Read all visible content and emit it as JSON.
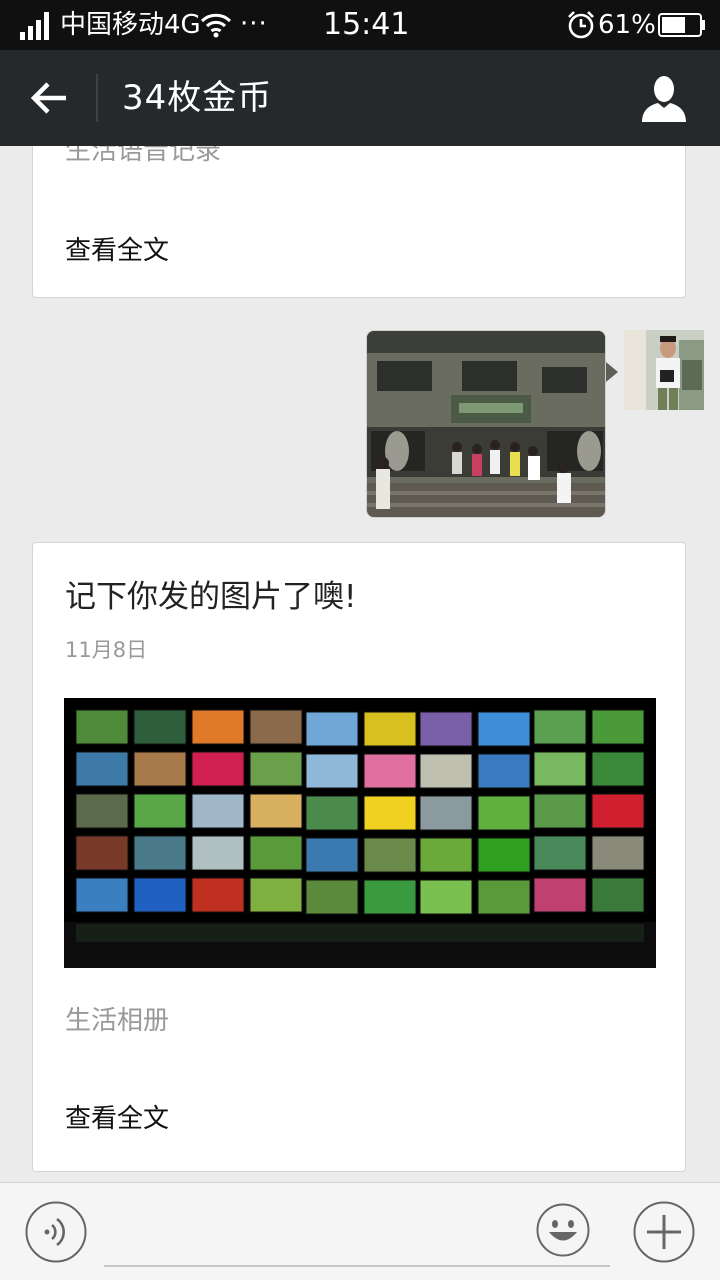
{
  "status_bar": {
    "carrier": "中国移动4G",
    "dots": "···",
    "time": "15:41",
    "battery_pct": "61%",
    "icons": [
      "signal-icon",
      "wifi-icon",
      "alarm-icon",
      "battery-icon"
    ]
  },
  "header": {
    "title": "34枚金币",
    "icons": [
      "back-arrow-icon",
      "profile-icon"
    ],
    "background": "#25292c"
  },
  "messages": [
    {
      "type": "card",
      "description": "生活语音记录",
      "view_all": "查看全文"
    },
    {
      "type": "image",
      "sender": "self",
      "image": "photo-building-entrance",
      "avatar": "avatar-photo"
    },
    {
      "type": "card",
      "title": "记下你发的图片了噢!",
      "date": "11月8日",
      "image": "photo-wall-of-screens",
      "description": "生活相册",
      "view_all": "查看全文"
    }
  ],
  "input_bar": {
    "placeholder": "",
    "icons": [
      "voice-icon",
      "emoji-icon",
      "plus-icon"
    ]
  },
  "colors": {
    "chat_background": "#ebebeb",
    "status_bar": "#101010",
    "title_bar": "#25292c",
    "muted_text": "#999999"
  }
}
